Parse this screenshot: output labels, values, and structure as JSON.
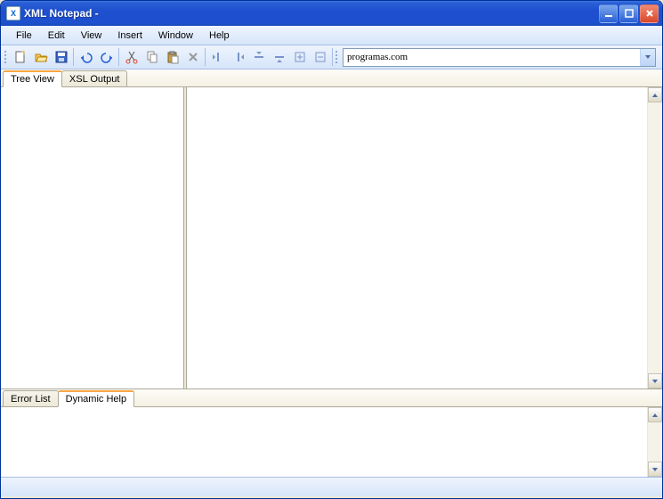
{
  "window": {
    "title": "XML Notepad -"
  },
  "menu": {
    "items": [
      "File",
      "Edit",
      "View",
      "Insert",
      "Window",
      "Help"
    ]
  },
  "toolbar": {
    "combo_value": "programas.com"
  },
  "tabs_top": {
    "tree_view": "Tree View",
    "xsl_output": "XSL Output",
    "active": "tree_view"
  },
  "tabs_bottom": {
    "error_list": "Error List",
    "dynamic_help": "Dynamic Help",
    "active": "dynamic_help"
  }
}
